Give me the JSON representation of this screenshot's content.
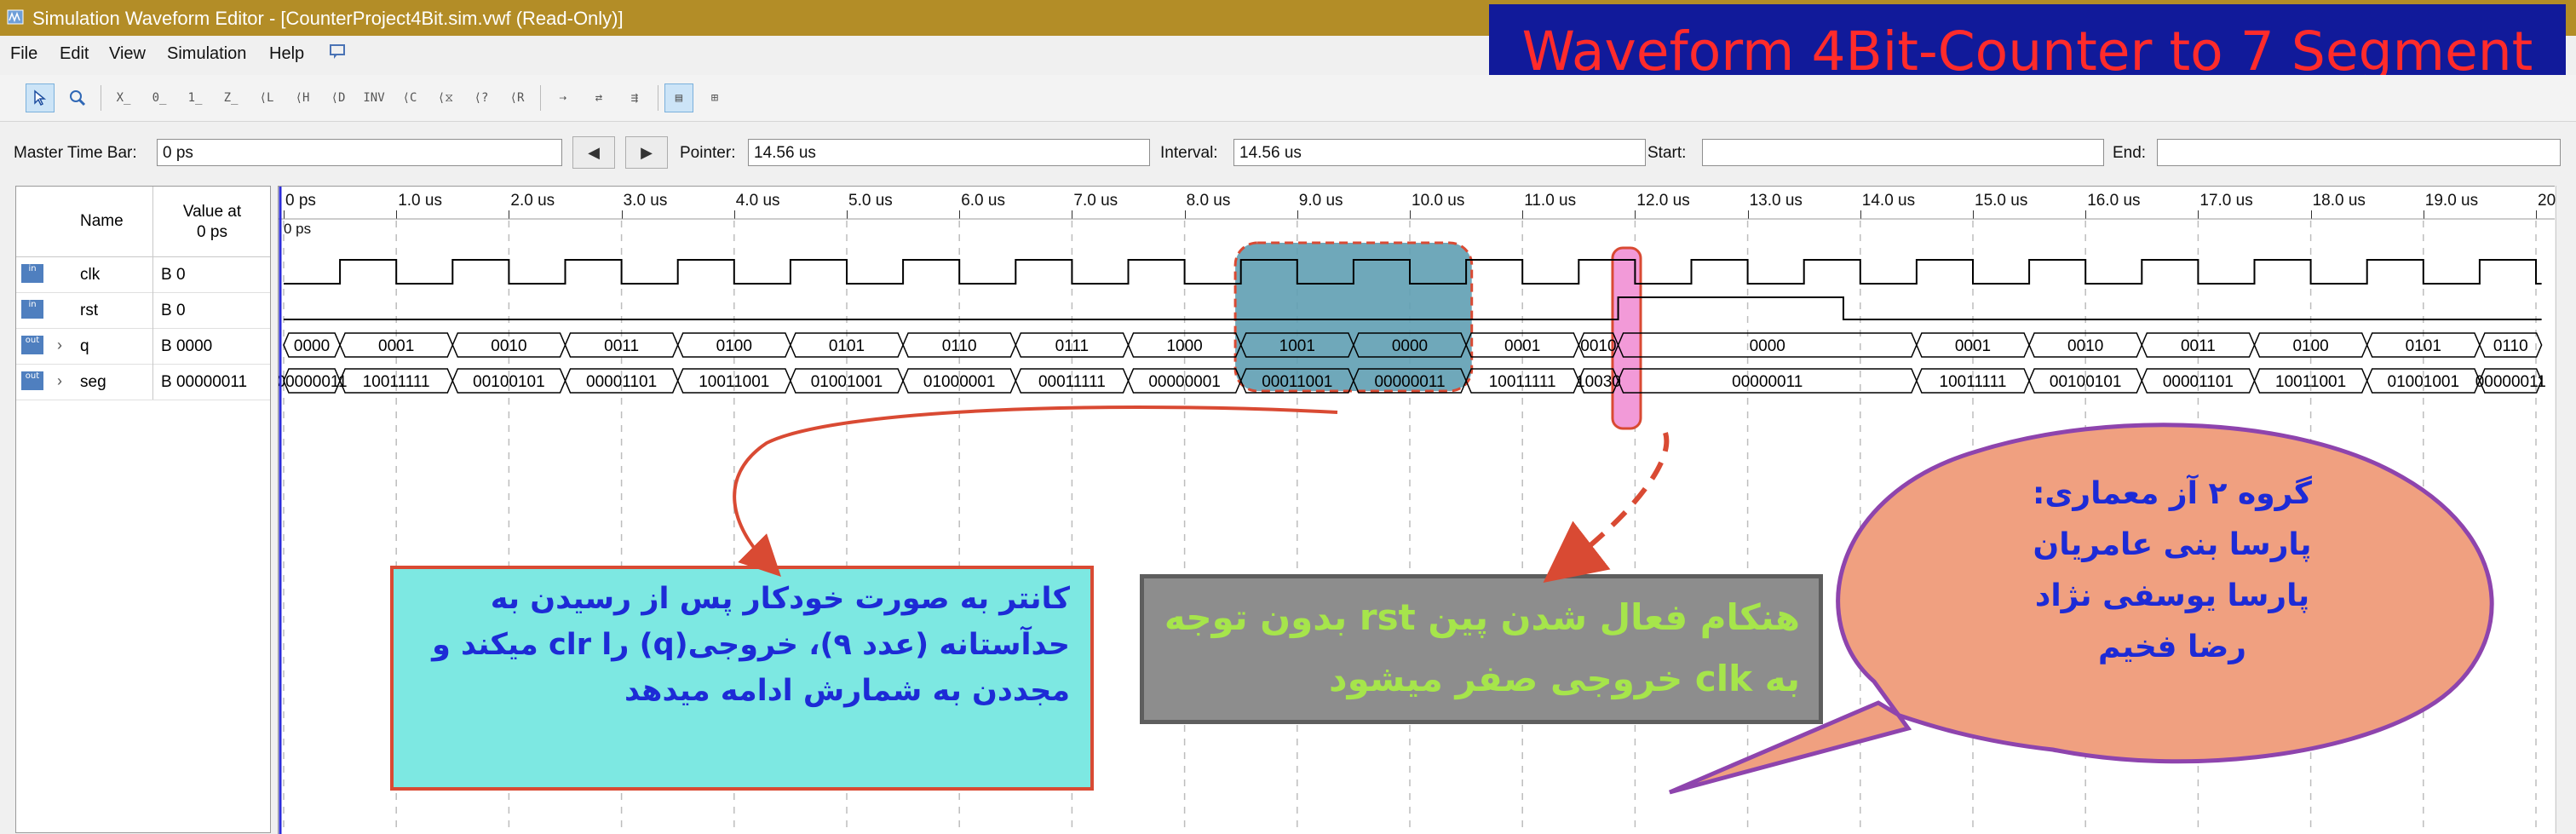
{
  "window": {
    "title": "Simulation Waveform Editor - [CounterProject4Bit.sim.vwf (Read-Only)]"
  },
  "banner": {
    "text": "Waveform 4Bit-Counter to 7 Segment"
  },
  "menu": [
    "File",
    "Edit",
    "View",
    "Simulation",
    "Help"
  ],
  "toolbar": {
    "icons": [
      "selection-tool-icon",
      "zoom-tool-icon",
      "force-unknown-icon",
      "force-low-icon",
      "force-high-icon",
      "force-high-impedance-icon",
      "force-weak-low-icon",
      "force-weak-high-icon",
      "force-dont-care-icon",
      "invert-icon",
      "count-value-icon",
      "overwrite-clock-icon",
      "random-values-icon",
      "arbitrary-value-icon",
      "snap-to-grid-icon",
      "group-icon",
      "ungroup-icon",
      "sort-icon",
      "grid-icon",
      "node-finder-icon"
    ]
  },
  "timebar": {
    "master_label": "Master Time Bar:",
    "master_value": "0 ps",
    "pointer_label": "Pointer:",
    "pointer_value": "14.56 us",
    "interval_label": "Interval:",
    "interval_value": "14.56 us",
    "start_label": "Start:",
    "start_value": "",
    "end_label": "End:",
    "end_value": ""
  },
  "signal_table": {
    "name_header": "Name",
    "value_header_line1": "Value at",
    "value_header_line2": "0 ps",
    "rows": [
      {
        "dir": "in",
        "name": "clk",
        "value": "B 0",
        "expandable": false
      },
      {
        "dir": "in",
        "name": "rst",
        "value": "B 0",
        "expandable": false
      },
      {
        "dir": "out",
        "name": "q",
        "value": "B 0000",
        "expandable": true
      },
      {
        "dir": "out",
        "name": "seg",
        "value": "B 00000011",
        "expandable": true
      }
    ]
  },
  "ruler": {
    "origin_label": "0 ps",
    "labels": [
      "0 ps",
      "1.0 us",
      "2.0 us",
      "3.0 us",
      "4.0 us",
      "5.0 us",
      "6.0 us",
      "7.0 us",
      "8.0 us",
      "9.0 us",
      "10.0 us",
      "11.0 us",
      "12.0 us",
      "13.0 us",
      "14.0 us",
      "15.0 us",
      "16.0 us",
      "17.0 us",
      "18.0 us",
      "19.0 us",
      "20.0 us"
    ]
  },
  "waveforms": {
    "clk_period_us": 1.0,
    "rst_high_from_us": 11.85,
    "rst_high_to_us": 13.85,
    "q_segments": [
      {
        "from": 0.0,
        "to": 0.5,
        "label": "0000"
      },
      {
        "from": 0.5,
        "to": 1.5,
        "label": "0001"
      },
      {
        "from": 1.5,
        "to": 2.5,
        "label": "0010"
      },
      {
        "from": 2.5,
        "to": 3.5,
        "label": "0011"
      },
      {
        "from": 3.5,
        "to": 4.5,
        "label": "0100"
      },
      {
        "from": 4.5,
        "to": 5.5,
        "label": "0101"
      },
      {
        "from": 5.5,
        "to": 6.5,
        "label": "0110"
      },
      {
        "from": 6.5,
        "to": 7.5,
        "label": "0111"
      },
      {
        "from": 7.5,
        "to": 8.5,
        "label": "1000"
      },
      {
        "from": 8.5,
        "to": 9.5,
        "label": "1001"
      },
      {
        "from": 9.5,
        "to": 10.5,
        "label": "0000"
      },
      {
        "from": 10.5,
        "to": 11.5,
        "label": "0001"
      },
      {
        "from": 11.5,
        "to": 11.85,
        "label": "0010"
      },
      {
        "from": 11.85,
        "to": 14.5,
        "label": "0000"
      },
      {
        "from": 14.5,
        "to": 15.5,
        "label": "0001"
      },
      {
        "from": 15.5,
        "to": 16.5,
        "label": "0010"
      },
      {
        "from": 16.5,
        "to": 17.5,
        "label": "0011"
      },
      {
        "from": 17.5,
        "to": 18.5,
        "label": "0100"
      },
      {
        "from": 18.5,
        "to": 19.5,
        "label": "0101"
      },
      {
        "from": 19.5,
        "to": 20.05,
        "label": "0110"
      }
    ],
    "seg_segments": [
      {
        "from": 0.0,
        "to": 0.5,
        "label": "00000011"
      },
      {
        "from": 0.5,
        "to": 1.5,
        "label": "10011111"
      },
      {
        "from": 1.5,
        "to": 2.5,
        "label": "00100101"
      },
      {
        "from": 2.5,
        "to": 3.5,
        "label": "00001101"
      },
      {
        "from": 3.5,
        "to": 4.5,
        "label": "10011001"
      },
      {
        "from": 4.5,
        "to": 5.5,
        "label": "01001001"
      },
      {
        "from": 5.5,
        "to": 6.5,
        "label": "01000001"
      },
      {
        "from": 6.5,
        "to": 7.5,
        "label": "00011111"
      },
      {
        "from": 7.5,
        "to": 8.5,
        "label": "00000001"
      },
      {
        "from": 8.5,
        "to": 9.5,
        "label": "00011001"
      },
      {
        "from": 9.5,
        "to": 10.5,
        "label": "00000011"
      },
      {
        "from": 10.5,
        "to": 11.5,
        "label": "10011111"
      },
      {
        "from": 11.5,
        "to": 11.85,
        "label": "10030"
      },
      {
        "from": 11.85,
        "to": 14.5,
        "label": "00000011"
      },
      {
        "from": 14.5,
        "to": 15.5,
        "label": "10011111"
      },
      {
        "from": 15.5,
        "to": 16.5,
        "label": "00100101"
      },
      {
        "from": 16.5,
        "to": 17.5,
        "label": "00001101"
      },
      {
        "from": 17.5,
        "to": 18.5,
        "label": "10011001"
      },
      {
        "from": 18.5,
        "to": 19.5,
        "label": "01001001"
      },
      {
        "from": 19.5,
        "to": 20.05,
        "label": "00000011"
      }
    ]
  },
  "annotations": {
    "callout_counter": "کانتر به صورت خودکار پس از رسیدن به حدآستانه (عدد ۹)، خروجی(q) را clr میکند و مجددن به شمارش ادامه میدهد",
    "callout_reset": "هنکام فعال شدن پین rst بدون توجه به clk خروجی صفر میشود",
    "bubble_title": "گروه ۲ آز معماری:",
    "bubble_members": [
      "پارسا بنی عامریان",
      "پارسا یوسفی نژاد",
      "رضا فخیم"
    ],
    "colors": {
      "highlight_teal": "#5f9fb3",
      "highlight_pink": "#f29ad8",
      "arrow_red": "#d94a33",
      "bubble_fill": "#f0a080",
      "bubble_border": "#8e44ad"
    }
  }
}
